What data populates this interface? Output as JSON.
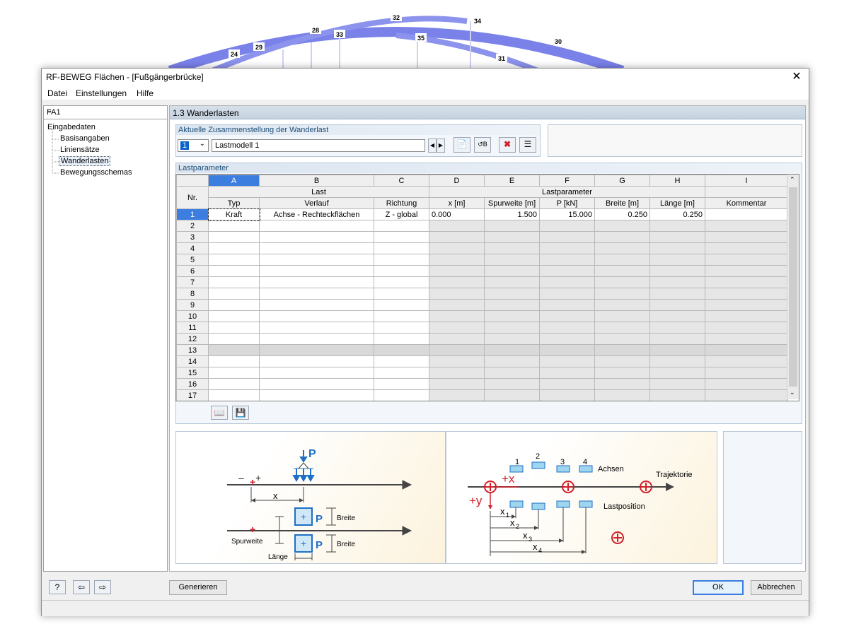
{
  "background_model": {
    "node_labels": [
      "24",
      "29",
      "28",
      "33",
      "32",
      "35",
      "34",
      "31",
      "30"
    ]
  },
  "window": {
    "title": "RF-BEWEG Flächen - [Fußgängerbrücke]",
    "close_glyph": "✕"
  },
  "menu": [
    "Datei",
    "Einstellungen",
    "Hilfe"
  ],
  "nav": {
    "selected": "FA1",
    "tree_root": "Eingabedaten",
    "tree_items": [
      "Basisangaben",
      "Liniensätze",
      "Wanderlasten",
      "Bewegungsschemas"
    ],
    "active_item": "Wanderlasten"
  },
  "section": {
    "title": "1.3 Wanderlasten"
  },
  "composition": {
    "group_title": "Aktuelle Zusammenstellung der Wanderlast",
    "number": "1",
    "name": "Lastmodell 1"
  },
  "params": {
    "group_title": "Lastparameter",
    "columns": [
      "A",
      "B",
      "C",
      "D",
      "E",
      "F",
      "G",
      "H",
      "I"
    ],
    "group_headers": {
      "last": "Last",
      "lastparameter": "Lastparameter"
    },
    "row_header": "Nr.",
    "subheaders": [
      "Typ",
      "Verlauf",
      "Richtung",
      "x [m]",
      "Spurweite [m]",
      "P [kN]",
      "Breite [m]",
      "Länge [m]",
      "Kommentar"
    ],
    "rows": [
      [
        "1",
        "Kraft",
        "Achse - Rechteckflächen",
        "Z - global",
        "0.000",
        "1.500",
        "15.000",
        "0.250",
        "0.250",
        ""
      ],
      [
        "2",
        "",
        "",
        "",
        "",
        "",
        "",
        "",
        "",
        ""
      ],
      [
        "3",
        "",
        "",
        "",
        "",
        "",
        "",
        "",
        "",
        ""
      ],
      [
        "4",
        "",
        "",
        "",
        "",
        "",
        "",
        "",
        "",
        ""
      ],
      [
        "5",
        "",
        "",
        "",
        "",
        "",
        "",
        "",
        "",
        ""
      ],
      [
        "6",
        "",
        "",
        "",
        "",
        "",
        "",
        "",
        "",
        ""
      ],
      [
        "7",
        "",
        "",
        "",
        "",
        "",
        "",
        "",
        "",
        ""
      ],
      [
        "8",
        "",
        "",
        "",
        "",
        "",
        "",
        "",
        "",
        ""
      ],
      [
        "9",
        "",
        "",
        "",
        "",
        "",
        "",
        "",
        "",
        ""
      ],
      [
        "10",
        "",
        "",
        "",
        "",
        "",
        "",
        "",
        "",
        ""
      ],
      [
        "11",
        "",
        "",
        "",
        "",
        "",
        "",
        "",
        "",
        ""
      ],
      [
        "12",
        "",
        "",
        "",
        "",
        "",
        "",
        "",
        "",
        ""
      ],
      [
        "13",
        "",
        "",
        "",
        "",
        "",
        "",
        "",
        "",
        ""
      ],
      [
        "14",
        "",
        "",
        "",
        "",
        "",
        "",
        "",
        "",
        ""
      ],
      [
        "15",
        "",
        "",
        "",
        "",
        "",
        "",
        "",
        "",
        ""
      ],
      [
        "16",
        "",
        "",
        "",
        "",
        "",
        "",
        "",
        "",
        ""
      ],
      [
        "17",
        "",
        "",
        "",
        "",
        "",
        "",
        "",
        "",
        ""
      ]
    ]
  },
  "diagram_left": {
    "p_label": "P",
    "x_label": "x",
    "minus": "–",
    "plus": "+",
    "breite_1": "Breite",
    "breite_2": "Breite",
    "spurweite": "Spurweite",
    "laenge": "Länge"
  },
  "diagram_right": {
    "axis_numbers": [
      "1",
      "2",
      "3",
      "4"
    ],
    "achsen": "Achsen",
    "trajektorie": "Trajektorie",
    "lastposition": "Lastposition",
    "plus_x": "+x",
    "plus_y": "+y",
    "x_labels": [
      "x",
      "x",
      "x",
      "x"
    ],
    "x_subs": [
      "1",
      "2",
      "3",
      "4"
    ]
  },
  "buttons": {
    "generate": "Generieren",
    "ok": "OK",
    "cancel": "Abbrechen"
  },
  "colors": {
    "accent_blue": "#1f6fc5",
    "red": "#d0202a",
    "model_blue": "#7b80e6"
  }
}
